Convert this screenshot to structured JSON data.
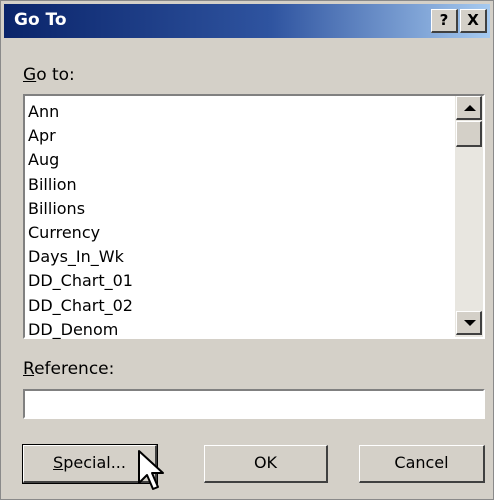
{
  "dialog": {
    "title": "Go To",
    "help_icon_label": "?",
    "close_icon_label": "X"
  },
  "goto_label": {
    "first": "G",
    "rest": "o to:"
  },
  "list": {
    "items": [
      "Ann",
      "Apr",
      "Aug",
      "Billion",
      "Billions",
      "Currency",
      "Days_In_Wk",
      "DD_Chart_01",
      "DD_Chart_02",
      "DD_Denom"
    ]
  },
  "reference_label": {
    "first": "R",
    "rest": "eference:"
  },
  "reference_input": {
    "value": "",
    "placeholder": ""
  },
  "buttons": {
    "special": {
      "first": "S",
      "rest": "pecial..."
    },
    "ok": "OK",
    "cancel": "Cancel"
  },
  "icons": {
    "help": "help-icon",
    "close": "close-icon",
    "scroll_up": "scroll-up-icon",
    "scroll_down": "scroll-down-icon",
    "cursor": "mouse-pointer-icon"
  },
  "colors": {
    "title_gradient_start": "#0a246a",
    "title_gradient_end": "#a6caf0",
    "dialog_face": "#d4d0c8"
  }
}
